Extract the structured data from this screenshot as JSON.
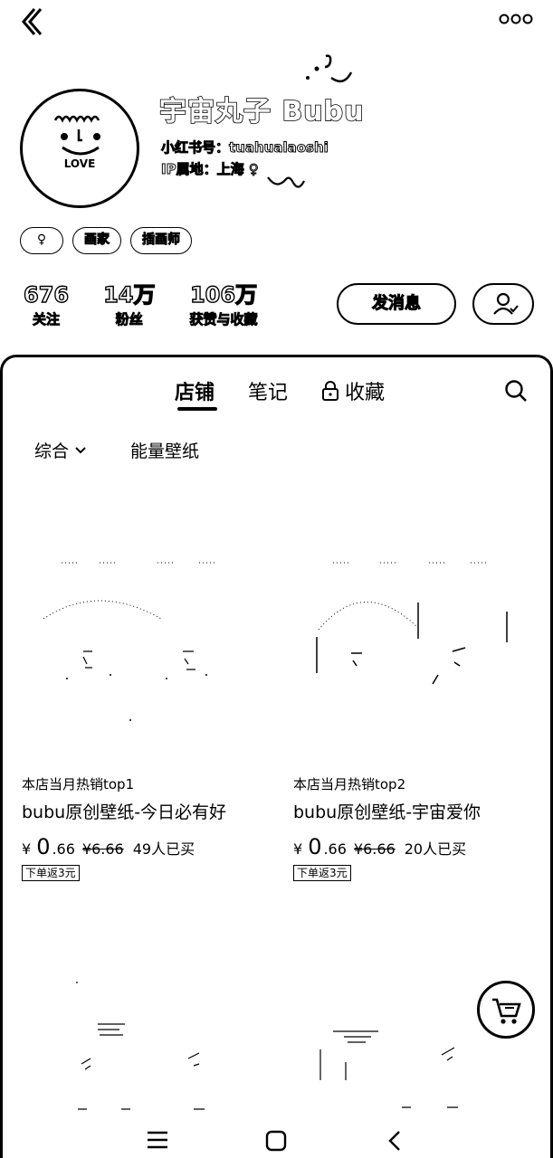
{
  "profile": {
    "name": "宇宙丸子 Bubu",
    "id_line": "小红书号：tuahualaoshi",
    "ip_line": "IP属地：上海 ♀",
    "tags": [
      "♀",
      "画家",
      "插画师"
    ],
    "stats": [
      {
        "num": "676",
        "label": "关注"
      },
      {
        "num": "14万",
        "label": "粉丝"
      },
      {
        "num": "106万",
        "label": "获赞与收藏"
      }
    ],
    "message_btn": "发消息",
    "avatar_text": "LOVE"
  },
  "tabs": {
    "store": "店铺",
    "notes": "笔记",
    "favorites": "收藏",
    "active": "store"
  },
  "filters": {
    "sort": "综合",
    "category": "能量壁纸"
  },
  "products": [
    {
      "hot": "本店当月热销top1",
      "title": "bubu原创壁纸-今日必有好",
      "currency": "¥",
      "price_int": "0",
      "price_dec": ".66",
      "orig": "¥6.66",
      "sold": "49人已买",
      "coupon": "下单返3元"
    },
    {
      "hot": "本店当月热销top2",
      "title": "bubu原创壁纸-宇宙爱你",
      "currency": "¥",
      "price_int": "0",
      "price_dec": ".66",
      "orig": "¥6.66",
      "sold": "20人已买",
      "coupon": "下单返3元"
    }
  ],
  "icons": {
    "back": "back-icon",
    "more": "more-icon",
    "lock": "lock-icon",
    "search": "search-icon",
    "chevron": "chevron-down-icon",
    "cart": "cart-icon",
    "person": "person-icon"
  }
}
